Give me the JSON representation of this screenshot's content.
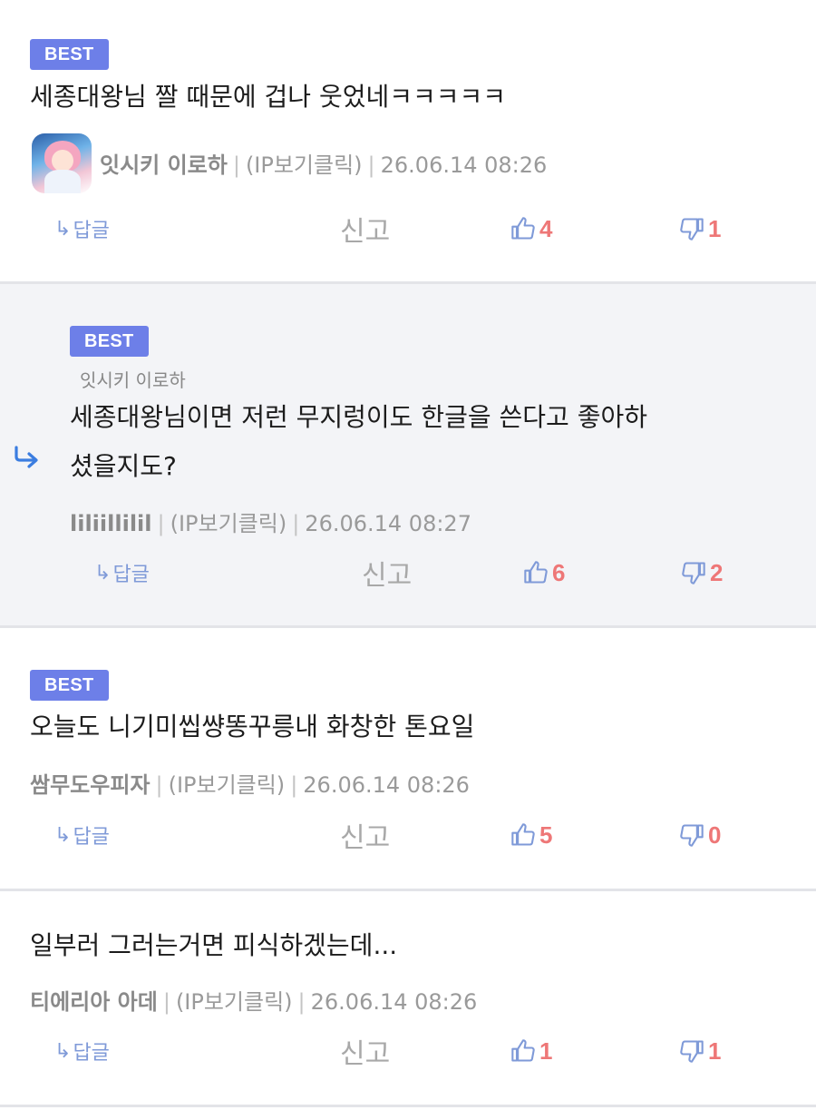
{
  "best_label": "BEST",
  "reply_label": "답글",
  "report_label": "신고",
  "ip_label": "(IP보기클릭)",
  "colors": {
    "badge": "#6d7fe8",
    "vote_count": "#ee7777",
    "reply_bg": "#f3f4f7",
    "icon_blue": "#7f9ad8"
  },
  "comments": [
    {
      "best": true,
      "text_lines": [
        "세종대왕님 짤 때문에 겁나 웃었네ㅋㅋㅋㅋㅋ"
      ],
      "author": "잇시키 이로하",
      "timestamp": "26.06.14 08:26",
      "likes": "4",
      "dislikes": "1",
      "has_avatar": true
    },
    {
      "best": true,
      "is_reply": true,
      "parent_author": "잇시키 이로하",
      "text_lines": [
        "세종대왕님이면 저런 무지렁이도 한글을 쓴다고 좋아하",
        "셨을지도?"
      ],
      "author": "liliillilil",
      "timestamp": "26.06.14 08:27",
      "likes": "6",
      "dislikes": "2"
    },
    {
      "best": true,
      "text_lines": [
        "오늘도 니기미씹썅똥꾸릉내 화창한 톤요일"
      ],
      "author": "쌈무도우피자",
      "timestamp": "26.06.14 08:26",
      "likes": "5",
      "dislikes": "0"
    },
    {
      "best": false,
      "text_lines": [
        "일부러 그러는거면 피식하겠는데..."
      ],
      "author": "티에리아 아데",
      "timestamp": "26.06.14 08:26",
      "likes": "1",
      "dislikes": "1"
    }
  ]
}
